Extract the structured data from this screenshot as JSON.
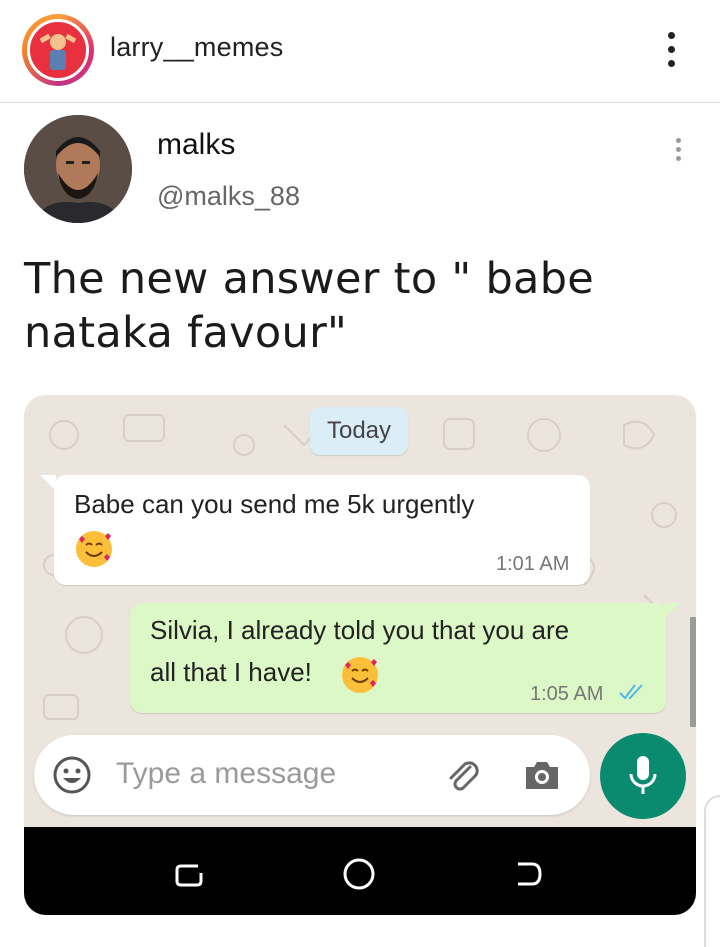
{
  "header": {
    "username": "larry__memes"
  },
  "tweet": {
    "name": "malks",
    "handle": "@malks_88",
    "text": "The new answer to \" babe nataka favour\""
  },
  "chat": {
    "date_label": "Today",
    "messages": [
      {
        "direction": "incoming",
        "text": "Babe can you send me 5k urgently",
        "time": "1:01 AM"
      },
      {
        "direction": "outgoing",
        "line1": "Silvia, I already told you that you are",
        "line2": "all that I have!",
        "time": "1:05 AM",
        "status": "read"
      }
    ],
    "input_placeholder": "Type a message"
  },
  "icons": {
    "header_menu": "more-vertical-icon",
    "tweet_menu": "more-vertical-icon",
    "emoji": "smiling-face-with-hearts-icon",
    "emoji_picker": "smiley-icon",
    "attach": "paperclip-icon",
    "camera": "camera-icon",
    "mic": "microphone-icon",
    "nav_recents": "recents-icon",
    "nav_home": "home-icon",
    "nav_back": "back-icon"
  },
  "colors": {
    "whatsapp_green": "#0a8a6e",
    "outgoing_bubble": "#dcf8c6",
    "read_ticks": "#4fb6ec",
    "ig_avatar_bg": "#e8303f"
  }
}
